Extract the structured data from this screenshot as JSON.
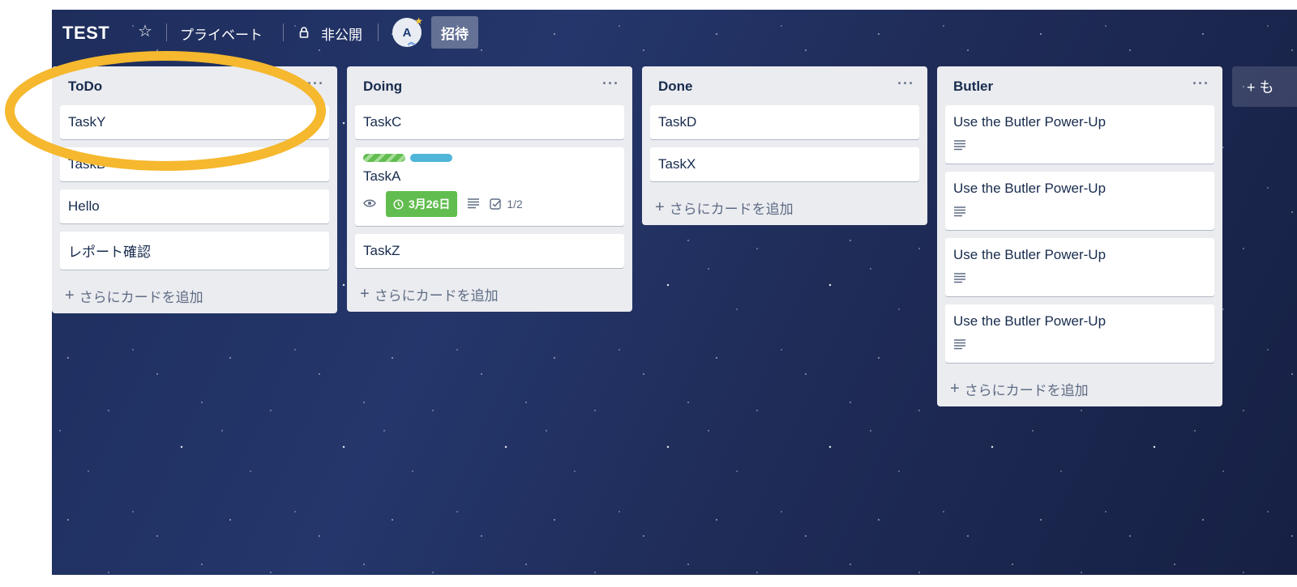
{
  "header": {
    "board_title": "TEST",
    "privacy": "プライベート",
    "visibility": "非公開",
    "avatar_initial": "A",
    "invite_label": "招待",
    "star_icon": "star-icon",
    "lock_icon": "lock-icon"
  },
  "lists": [
    {
      "title": "ToDo",
      "menu": "···",
      "cards": [
        {
          "title": "TaskY"
        },
        {
          "title": "TaskB"
        },
        {
          "title": "Hello"
        },
        {
          "title": "レポート確認"
        }
      ],
      "add_card": "さらにカードを追加"
    },
    {
      "title": "Doing",
      "menu": "···",
      "cards": [
        {
          "title": "TaskC"
        },
        {
          "title": "TaskA",
          "labels": [
            "#61bd4f",
            "#4fb5d9"
          ],
          "due": "3月26日",
          "checklist": "1/2"
        },
        {
          "title": "TaskZ"
        }
      ],
      "add_card": "さらにカードを追加"
    },
    {
      "title": "Done",
      "menu": "···",
      "cards": [
        {
          "title": "TaskD"
        },
        {
          "title": "TaskX"
        }
      ],
      "add_card": "さらにカードを追加"
    },
    {
      "title": "Butler",
      "menu": "···",
      "cards": [
        {
          "title": "Use the Butler Power-Up"
        },
        {
          "title": "Use the Butler Power-Up"
        },
        {
          "title": "Use the Butler Power-Up"
        },
        {
          "title": "Use the Butler Power-Up"
        }
      ],
      "add_card": "さらにカードを追加"
    }
  ],
  "add_list": "+ も",
  "colors": {
    "highlight": "#f5b82e",
    "due_green": "#61bd4f",
    "list_bg": "#ebecf0"
  }
}
